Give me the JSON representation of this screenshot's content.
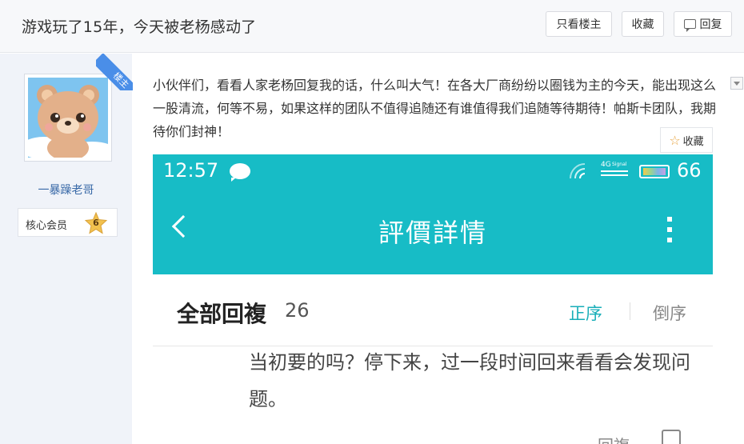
{
  "thread": {
    "title": "游戏玩了15年，今天被老杨感动了",
    "buttons": {
      "only_op": "只看楼主",
      "favorite": "收藏",
      "reply": "回复"
    }
  },
  "author": {
    "username": "一暴躁老哥",
    "rank_label": "核心会员",
    "rank_level": "6",
    "op_ribbon": "楼主"
  },
  "post": {
    "content": "小伙伴们，看看人家老杨回复我的话，什么叫大气！在各大厂商纷纷以圈钱为主的今天，能出现这么一股清流，何等不易，如果这样的团队不值得追随还有谁值得我们追随等待期待！帕斯卡团队，我期待你们封神！",
    "fav_float": "收藏"
  },
  "screenshot": {
    "time": "12:57",
    "battery_pct": "66",
    "network_label": "4G",
    "signal_label": "Signal",
    "app_title": "評價詳情",
    "all_replies": "全部回複",
    "reply_count": "26",
    "sort_asc": "正序",
    "sort_desc": "倒序",
    "comment_text": "当初要的吗？停下来，过一段时间回来看看会发现问题。",
    "reply_link": "回複"
  },
  "colors": {
    "accent": "#17bcc6",
    "ribbon": "#4a8ee8",
    "link": "#3a6aa8"
  }
}
